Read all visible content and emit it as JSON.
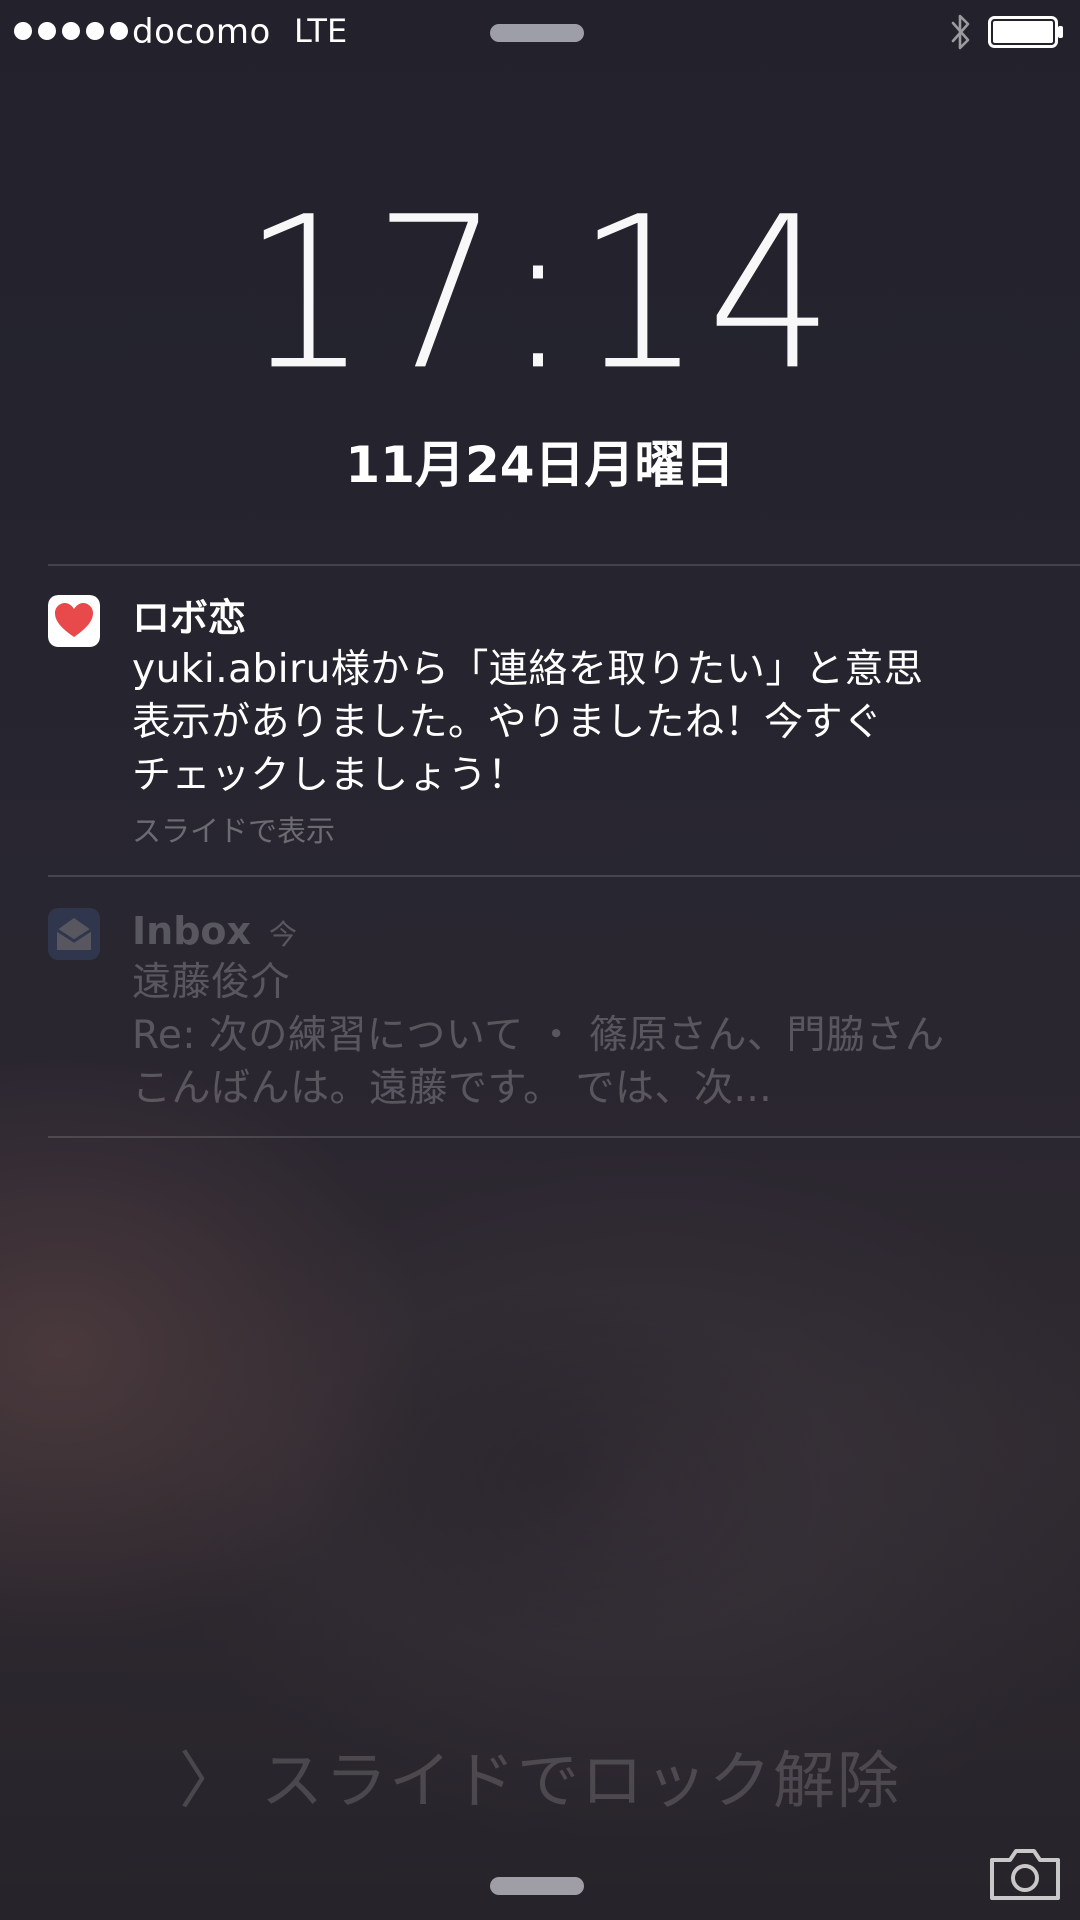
{
  "status_bar": {
    "carrier": "docomo",
    "network": "LTE",
    "icons": [
      "signal-dots",
      "bluetooth-icon",
      "battery-icon"
    ]
  },
  "lock_screen": {
    "time": "17:14",
    "date": "11月24日月曜日",
    "unlock_chevron": "〉",
    "unlock_text": "スライドでロック解除"
  },
  "notifications": [
    {
      "app_name": "ロボ恋",
      "icon": "heart-icon",
      "message_lines": [
        "yuki.abiru様から「連絡を取りたい」と意思",
        "表示がありました。やりましたね！今すぐ",
        "チェックしましょう！"
      ],
      "hint": "スライドで表示"
    },
    {
      "app_name": "Inbox",
      "icon": "envelope-icon",
      "time": "今",
      "sender": "遠藤俊介",
      "preview_lines": [
        "Re: 次の練習について ・ 篠原さん、門脇さん",
        "こんばんは。遠藤です。 では、次..."
      ]
    }
  ],
  "colors": {
    "heart": "#e8494a",
    "inbox_icon": "#4a6fb5",
    "text": "#ffffff"
  }
}
